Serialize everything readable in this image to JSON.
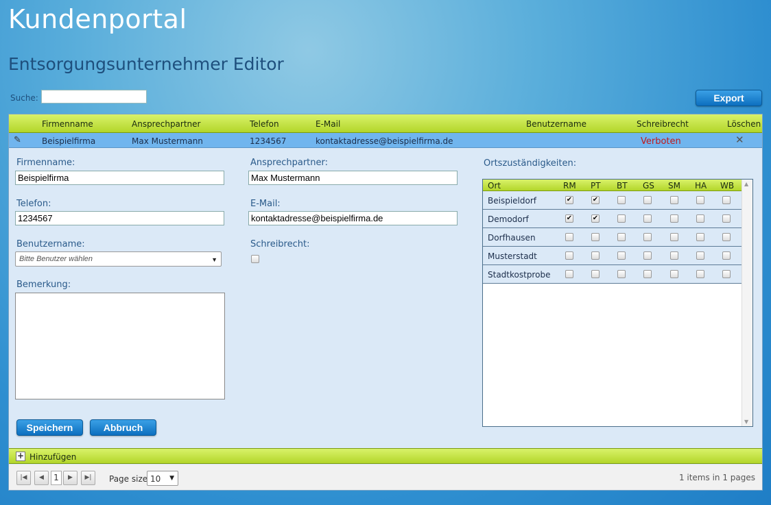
{
  "app_title": "Kundenportal",
  "page_title": "Entsorgungsunternehmer Editor",
  "search": {
    "label": "Suche:",
    "value": ""
  },
  "export_label": "Export",
  "grid": {
    "columns": [
      "Firmenname",
      "Ansprechpartner",
      "Telefon",
      "E-Mail",
      "Benutzername",
      "Schreibrecht",
      "Löschen"
    ],
    "row": {
      "firmenname": "Beispielfirma",
      "ansprechpartner": "Max Mustermann",
      "telefon": "1234567",
      "email": "kontaktadresse@beispielfirma.de",
      "benutzername": "",
      "schreibrecht": "Verboten",
      "delete_glyph": "✕",
      "edit_glyph": "✎"
    }
  },
  "editor": {
    "firmenname_label": "Firmenname:",
    "firmenname_value": "Beispielfirma",
    "ansprechpartner_label": "Ansprechpartner:",
    "ansprechpartner_value": "Max Mustermann",
    "telefon_label": "Telefon:",
    "telefon_value": "1234567",
    "email_label": "E-Mail:",
    "email_value": "kontaktadresse@beispielfirma.de",
    "benutzername_label": "Benutzername:",
    "benutzername_placeholder": "Bitte Benutzer wählen",
    "schreibrecht_label": "Schreibrecht:",
    "schreibrecht_checked": false,
    "bemerkung_label": "Bemerkung:",
    "bemerkung_value": "",
    "save_label": "Speichern",
    "cancel_label": "Abbruch"
  },
  "orts": {
    "label": "Ortszuständigkeiten:",
    "columns": [
      "Ort",
      "RM",
      "PT",
      "BT",
      "GS",
      "SM",
      "HA",
      "WB"
    ],
    "rows": [
      {
        "ort": "Beispieldorf",
        "checks": [
          true,
          true,
          false,
          false,
          false,
          false,
          false
        ]
      },
      {
        "ort": "Demodorf",
        "checks": [
          true,
          true,
          false,
          false,
          false,
          false,
          false
        ]
      },
      {
        "ort": "Dorfhausen",
        "checks": [
          false,
          false,
          false,
          false,
          false,
          false,
          false
        ]
      },
      {
        "ort": "Musterstadt",
        "checks": [
          false,
          false,
          false,
          false,
          false,
          false,
          false
        ]
      },
      {
        "ort": "Stadtkostprobe",
        "checks": [
          false,
          false,
          false,
          false,
          false,
          false,
          false
        ]
      }
    ]
  },
  "add_label": "Hinzufügen",
  "pager": {
    "current_page": "1",
    "page_size_label": "Page size:",
    "page_size": "10",
    "info": "1 items in 1 pages"
  }
}
